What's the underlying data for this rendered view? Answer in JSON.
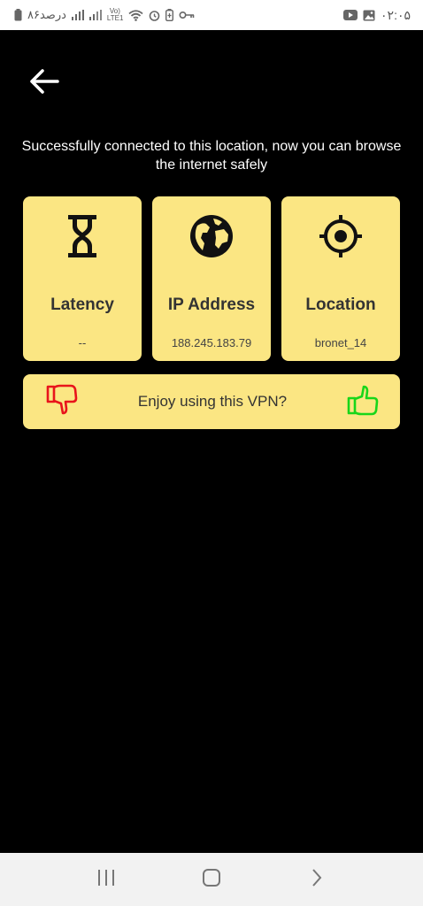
{
  "status_bar": {
    "left_text": "٨۶درصد",
    "network": "Vo) LTE1",
    "time": "۰۲:۰۵",
    "icons": [
      "battery-icon",
      "signal-icon",
      "signal-icon",
      "wifi-icon",
      "alarm-icon",
      "battery-saver-icon",
      "vpn-key-icon",
      "youtube-icon",
      "gallery-icon"
    ]
  },
  "header": {
    "back_icon": "arrow-left-icon"
  },
  "message": "Successfully connected to this location, now you can browse the internet safely",
  "cards": [
    {
      "icon": "hourglass-icon",
      "title": "Latency",
      "value": "--"
    },
    {
      "icon": "globe-icon",
      "title": "IP Address",
      "value": "188.245.183.79"
    },
    {
      "icon": "crosshair-icon",
      "title": "Location",
      "value": "bronet_14"
    }
  ],
  "feedback": {
    "text": "Enjoy using this VPN?",
    "dislike_icon": "thumbs-down-icon",
    "like_icon": "thumbs-up-icon",
    "colors": {
      "dislike": "#e8141b",
      "like": "#18d61a",
      "background": "#fbe683"
    }
  },
  "nav_bar": {
    "items": [
      "recent-apps-icon",
      "home-icon",
      "back-icon"
    ]
  }
}
